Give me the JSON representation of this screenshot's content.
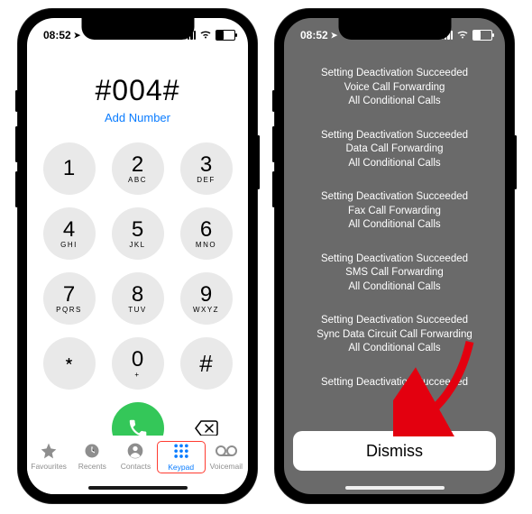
{
  "status": {
    "time": "08:52",
    "loc_icon": "➤"
  },
  "dialer": {
    "display": "#004#",
    "add_number": "Add Number",
    "keys": [
      {
        "d": "1",
        "s": ""
      },
      {
        "d": "2",
        "s": "ABC"
      },
      {
        "d": "3",
        "s": "DEF"
      },
      {
        "d": "4",
        "s": "GHI"
      },
      {
        "d": "5",
        "s": "JKL"
      },
      {
        "d": "6",
        "s": "MNO"
      },
      {
        "d": "7",
        "s": "PQRS"
      },
      {
        "d": "8",
        "s": "TUV"
      },
      {
        "d": "9",
        "s": "WXYZ"
      },
      {
        "d": "﹡",
        "s": ""
      },
      {
        "d": "0",
        "s": "+"
      },
      {
        "d": "#",
        "s": ""
      }
    ]
  },
  "tabs": {
    "favourites": "Favourites",
    "recents": "Recents",
    "contacts": "Contacts",
    "keypad": "Keypad",
    "voicemail": "Voicemail"
  },
  "result": {
    "blocks": [
      [
        "Setting Deactivation Succeeded",
        "Voice Call Forwarding",
        "All Conditional Calls"
      ],
      [
        "Setting Deactivation Succeeded",
        "Data Call Forwarding",
        "All Conditional Calls"
      ],
      [
        "Setting Deactivation Succeeded",
        "Fax Call Forwarding",
        "All Conditional Calls"
      ],
      [
        "Setting Deactivation Succeeded",
        "SMS Call Forwarding",
        "All Conditional Calls"
      ],
      [
        "Setting Deactivation Succeeded",
        "Sync Data Circuit Call Forwarding",
        "All Conditional Calls"
      ],
      [
        "Setting Deactivation Succeeded"
      ]
    ],
    "dismiss": "Dismiss"
  }
}
